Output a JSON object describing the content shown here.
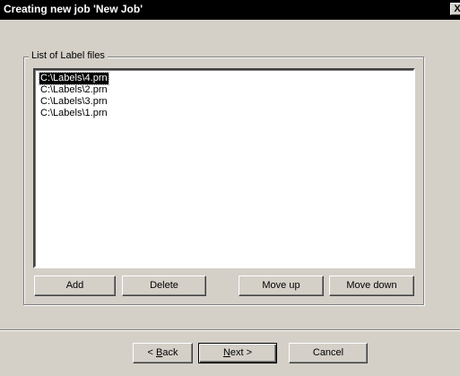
{
  "window": {
    "title": "Creating new job 'New Job'",
    "close_glyph": "X"
  },
  "group": {
    "legend": "List of Label files"
  },
  "files": [
    "C:\\Labels\\4.prn",
    "C:\\Labels\\2.prn",
    "C:\\Labels\\3.prn",
    "C:\\Labels\\1.prn"
  ],
  "selected_index": 0,
  "list_buttons": {
    "add": "Add",
    "delete": "Delete",
    "move_up": "Move up",
    "move_down": "Move down"
  },
  "wizard_buttons": {
    "back_prefix": "< ",
    "back_mnemonic": "B",
    "back_rest": "ack",
    "next_mnemonic": "N",
    "next_rest": "ext >",
    "cancel": "Cancel"
  },
  "colors": {
    "titlebar": "#000000",
    "face": "#d4d0c8",
    "selection": "#000000"
  }
}
